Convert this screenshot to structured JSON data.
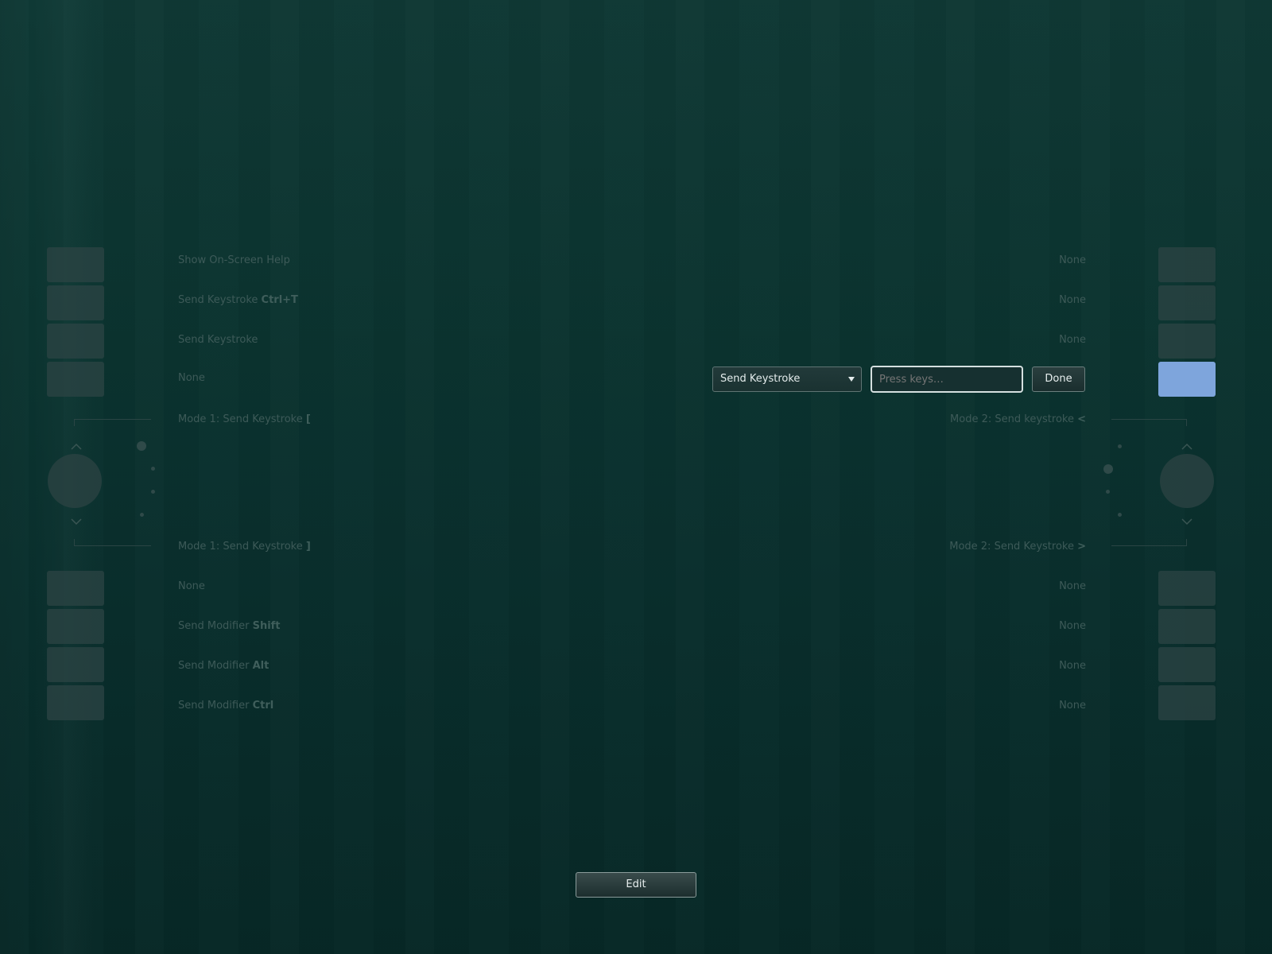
{
  "left_labels": [
    {
      "text": "Show On-Screen Help",
      "bold": ""
    },
    {
      "text": "Send Keystroke ",
      "bold": "Ctrl+T"
    },
    {
      "text": "Send Keystroke",
      "bold": ""
    },
    {
      "text": "None",
      "bold": ""
    }
  ],
  "left_ring": {
    "top": {
      "text": "Mode 1: Send Keystroke ",
      "bold": "["
    },
    "bottom": {
      "text": "Mode 1: Send Keystroke ",
      "bold": "]"
    }
  },
  "left_bottom_labels": [
    {
      "text": "None",
      "bold": ""
    },
    {
      "text": "Send Modifier ",
      "bold": "Shift"
    },
    {
      "text": "Send Modifier ",
      "bold": "Alt"
    },
    {
      "text": "Send Modifier ",
      "bold": "Ctrl"
    }
  ],
  "right_labels": [
    "None",
    "None",
    "None"
  ],
  "right_ring": {
    "top": {
      "text": "Mode 2: Send keystroke ",
      "bold": "<"
    },
    "bottom": {
      "text": "Mode 2: Send Keystroke ",
      "bold": ">"
    }
  },
  "right_bottom_labels": [
    "None",
    "None",
    "None",
    "None"
  ],
  "editor": {
    "action_selected": "Send Keystroke",
    "keys_placeholder": "Press keys…",
    "done_label": "Done"
  },
  "edit_button_label": "Edit",
  "colors": {
    "active_button": "#7ea5dc",
    "background": "#0b3531"
  }
}
